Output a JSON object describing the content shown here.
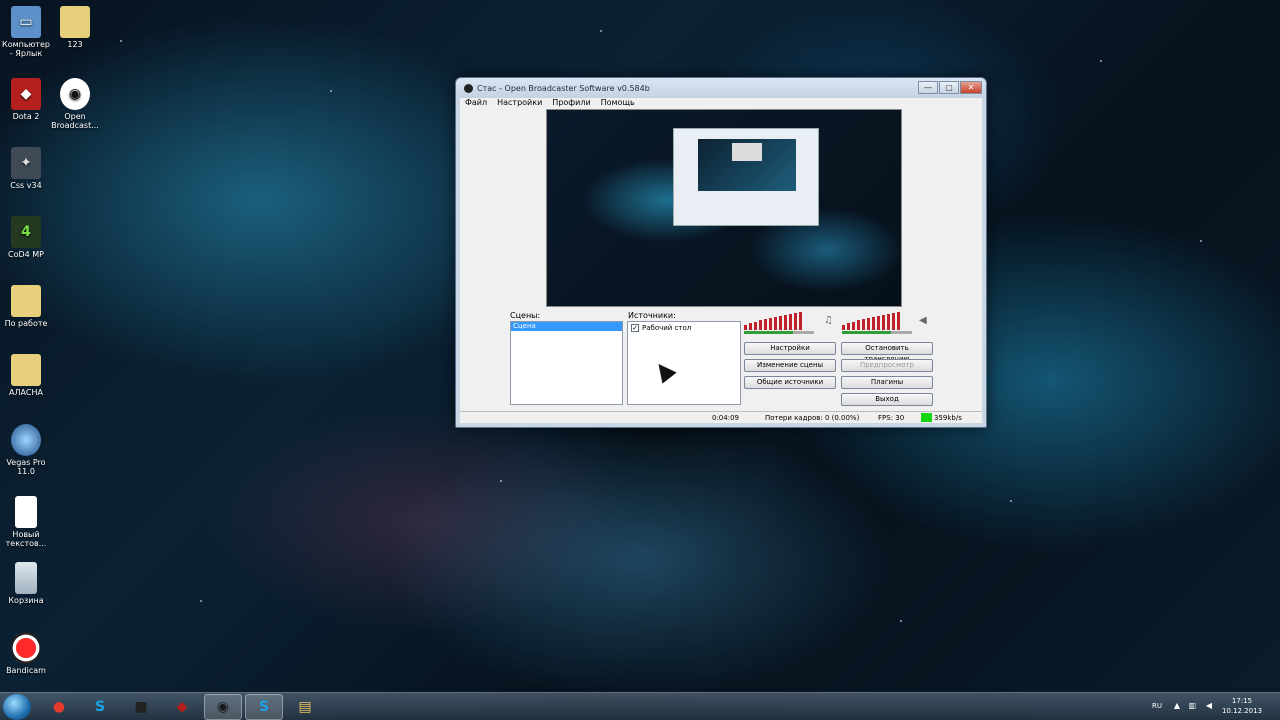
{
  "desktop_icons": [
    {
      "label": "Компьютер - Ярлык",
      "icon": "computer-icon"
    },
    {
      "label": "123",
      "icon": "folder-icon"
    },
    {
      "label": "Dota 2",
      "icon": "dota2-icon"
    },
    {
      "label": "Open Broadcast...",
      "icon": "obs-icon"
    },
    {
      "label": "Css v34",
      "icon": "css-icon"
    },
    {
      "label": "CoD4 MP",
      "icon": "cod4-icon"
    },
    {
      "label": "По работе",
      "icon": "folder-icon"
    },
    {
      "label": "АЛАСНА",
      "icon": "folder-icon"
    },
    {
      "label": "Vegas Pro 11.0",
      "icon": "vegas-icon"
    },
    {
      "label": "Новый текстов...",
      "icon": "text-file-icon"
    },
    {
      "label": "Корзина",
      "icon": "recycle-bin-icon"
    },
    {
      "label": "Bandicam",
      "icon": "bandicam-icon"
    }
  ],
  "window": {
    "title": "Стас - Open Broadcaster Software v0.584b",
    "minimize": "—",
    "maximize": "▢",
    "close": "✕"
  },
  "menu": [
    "Файл",
    "Настройки",
    "Профили",
    "Помощь"
  ],
  "scenes": {
    "label": "Сцены:",
    "items": [
      "Сцена"
    ]
  },
  "sources": {
    "label": "Источники:",
    "items": [
      {
        "label": "Рабочий стол",
        "checked": true,
        "check_mark": "✓"
      }
    ]
  },
  "buttons": {
    "settings": "Настройки",
    "stop_stream": "Остановить трансляцию",
    "edit_scene": "Изменение сцены",
    "preview": "Предпросмотр",
    "global_sources": "Общие источники",
    "plugins": "Плагины",
    "exit": "Выход"
  },
  "status": {
    "time": "0:04:09",
    "dropped_frames": "Потери кадров: 0 (0.00%)",
    "fps": "FPS: 30",
    "bitrate": "359kb/s",
    "status_color": "#11d611"
  },
  "taskbar": {
    "apps": [
      "chrome-icon",
      "skype-icon",
      "media-player-icon",
      "dota2-icon",
      "obs-icon",
      "skype-icon",
      "explorer-icon"
    ],
    "app_glyphs": [
      "●",
      "S",
      "■",
      "◆",
      "◉",
      "S",
      "▤"
    ],
    "app_colors": [
      "#e23b2e",
      "#1aa3e8",
      "#222222",
      "#b3201d",
      "#1b1b1b",
      "#1aa3e8",
      "#e6c25a"
    ],
    "language": "RU",
    "time": "17:15",
    "date": "10.12.2013"
  }
}
